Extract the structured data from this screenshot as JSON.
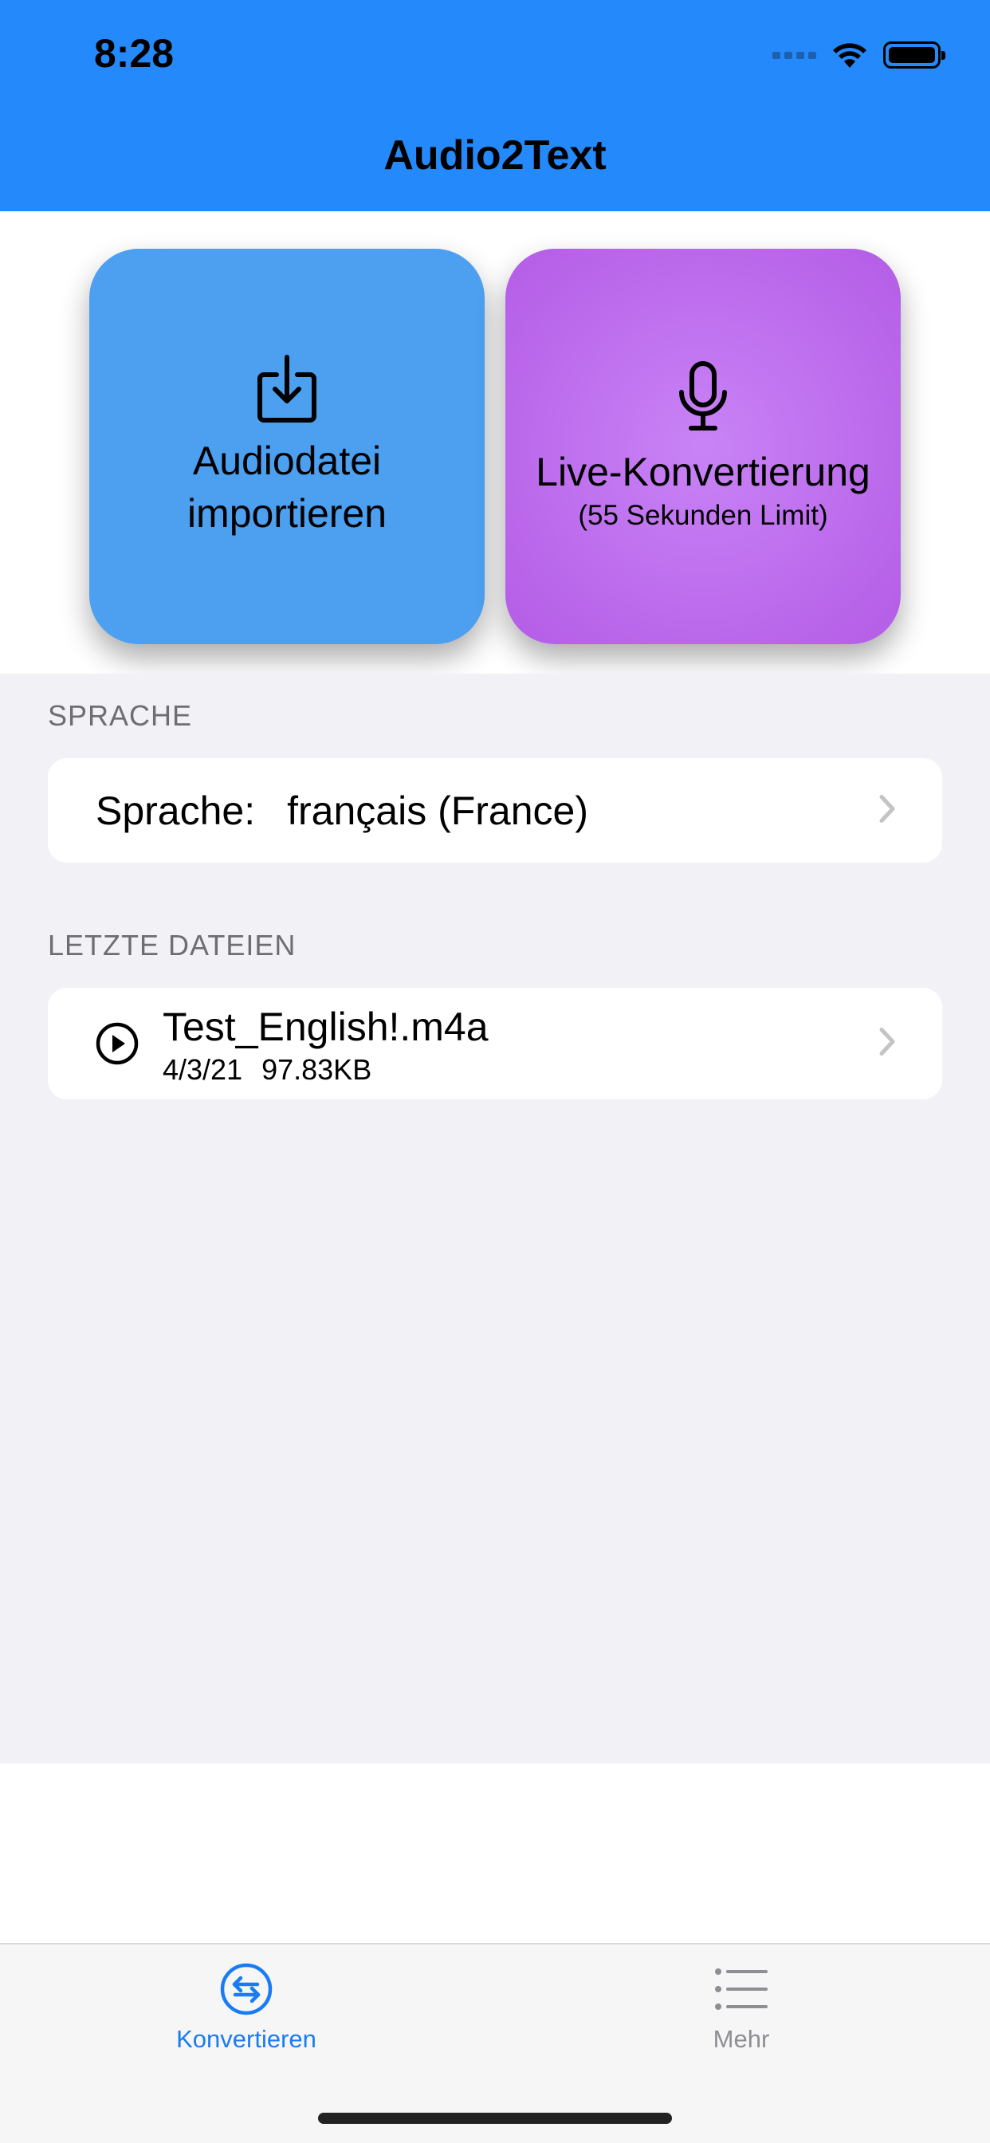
{
  "status_bar": {
    "time": "8:28"
  },
  "header": {
    "title": "Audio2Text"
  },
  "tiles": {
    "import": {
      "label_line1": "Audiodatei",
      "label_line2": "importieren",
      "icon": "download-tray-icon"
    },
    "live": {
      "label": "Live-Konvertierung",
      "sublabel": "(55 Sekunden Limit)",
      "icon": "microphone-icon"
    }
  },
  "language_section": {
    "title": "SPRACHE",
    "label": "Sprache:",
    "value": "français (France)"
  },
  "recent_section": {
    "title": "LETZTE DATEIEN",
    "files": [
      {
        "name": "Test_English!.m4a",
        "date": "4/3/21",
        "size": "97.83KB"
      }
    ]
  },
  "tabbar": {
    "tabs": [
      {
        "label": "Konvertieren",
        "icon": "convert-arrows-icon",
        "selected": true
      },
      {
        "label": "Mehr",
        "icon": "list-icon",
        "selected": false
      }
    ]
  },
  "colors": {
    "header": "#2489fb",
    "import_tile": "#4d9ff0",
    "live_tile": "#b45ce6",
    "accent": "#1a7cf3"
  }
}
